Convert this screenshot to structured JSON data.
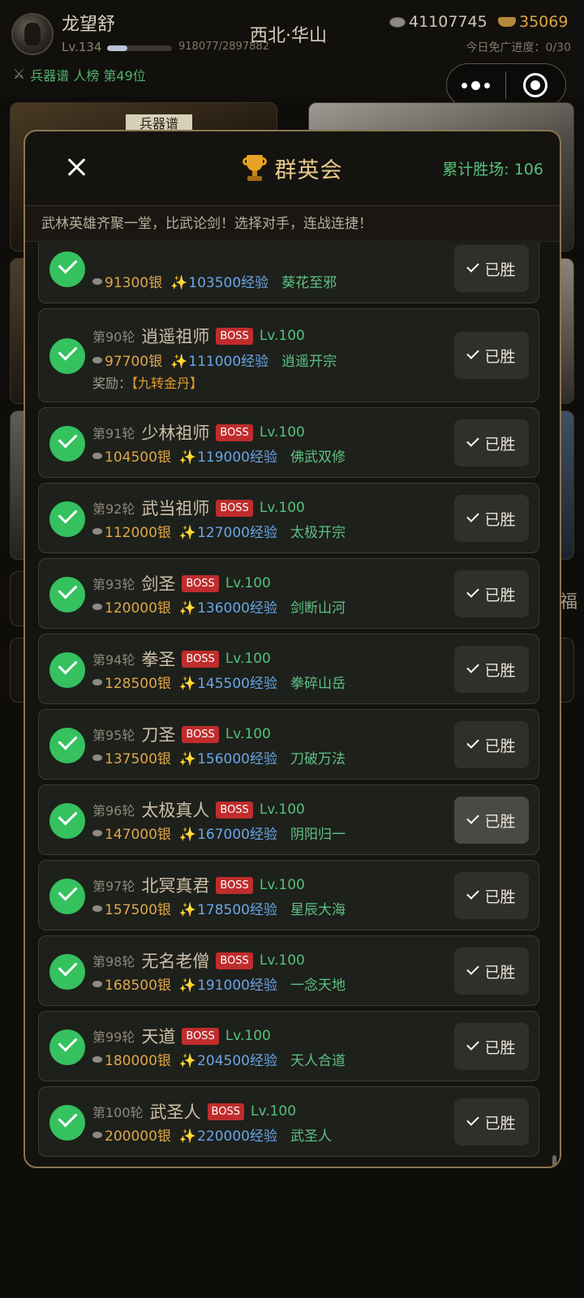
{
  "player": {
    "name": "龙望舒",
    "level": "Lv.134",
    "exp_text": "918077/2897882",
    "exp_fraction": 0.317,
    "location": "西北·华山",
    "silver": "41107745",
    "gold": "35069",
    "free_ad_progress": "今日免广进度：0/30",
    "rank": "兵器谱 人榜 第49位"
  },
  "background": {
    "sign": "兵器谱",
    "side_glyph": "福"
  },
  "modal": {
    "title": "群英会",
    "total_wins": "累计胜场: 106",
    "description": "武林英雄齐聚一堂，比武论剑！选择对手，连战连捷！",
    "won_label": "已胜",
    "reward_prefix": "奖励：",
    "items": [
      {
        "round": "",
        "name": "",
        "boss": "",
        "lv": "",
        "silver": "91300银",
        "exp": "103500经验",
        "skill": "葵花至邪",
        "reward": ""
      },
      {
        "round": "第90轮",
        "name": "逍遥祖师",
        "boss": "BOSS",
        "lv": "Lv.100",
        "silver": "97700银",
        "exp": "111000经验",
        "skill": "逍遥开宗",
        "reward": "【九转金丹】"
      },
      {
        "round": "第91轮",
        "name": "少林祖师",
        "boss": "BOSS",
        "lv": "Lv.100",
        "silver": "104500银",
        "exp": "119000经验",
        "skill": "佛武双修",
        "reward": ""
      },
      {
        "round": "第92轮",
        "name": "武当祖师",
        "boss": "BOSS",
        "lv": "Lv.100",
        "silver": "112000银",
        "exp": "127000经验",
        "skill": "太极开宗",
        "reward": ""
      },
      {
        "round": "第93轮",
        "name": "剑圣",
        "boss": "BOSS",
        "lv": "Lv.100",
        "silver": "120000银",
        "exp": "136000经验",
        "skill": "剑断山河",
        "reward": ""
      },
      {
        "round": "第94轮",
        "name": "拳圣",
        "boss": "BOSS",
        "lv": "Lv.100",
        "silver": "128500银",
        "exp": "145500经验",
        "skill": "拳碎山岳",
        "reward": ""
      },
      {
        "round": "第95轮",
        "name": "刀圣",
        "boss": "BOSS",
        "lv": "Lv.100",
        "silver": "137500银",
        "exp": "156000经验",
        "skill": "刀破万法",
        "reward": ""
      },
      {
        "round": "第96轮",
        "name": "太极真人",
        "boss": "BOSS",
        "lv": "Lv.100",
        "silver": "147000银",
        "exp": "167000经验",
        "skill": "阴阳归一",
        "reward": ""
      },
      {
        "round": "第97轮",
        "name": "北冥真君",
        "boss": "BOSS",
        "lv": "Lv.100",
        "silver": "157500银",
        "exp": "178500经验",
        "skill": "星辰大海",
        "reward": ""
      },
      {
        "round": "第98轮",
        "name": "无名老僧",
        "boss": "BOSS",
        "lv": "Lv.100",
        "silver": "168500银",
        "exp": "191000经验",
        "skill": "一念天地",
        "reward": ""
      },
      {
        "round": "第99轮",
        "name": "天道",
        "boss": "BOSS",
        "lv": "Lv.100",
        "silver": "180000银",
        "exp": "204500经验",
        "skill": "天人合道",
        "reward": ""
      },
      {
        "round": "第100轮",
        "name": "武圣人",
        "boss": "BOSS",
        "lv": "Lv.100",
        "silver": "200000银",
        "exp": "220000经验",
        "skill": "武圣人",
        "reward": ""
      }
    ]
  },
  "colors": {
    "accent_gold": "#e8ca8c",
    "win_green": "#34c15e",
    "boss_red": "#bf2c2c",
    "exp_blue": "#69a6e8",
    "silver_orange": "#dfa74a"
  },
  "icons": [
    "avatar",
    "swords-icon",
    "coin-icon",
    "ingot-icon",
    "more-icon",
    "capsule-close-icon",
    "close-icon",
    "trophy-icon",
    "check-icon",
    "sparkle-icon"
  ]
}
